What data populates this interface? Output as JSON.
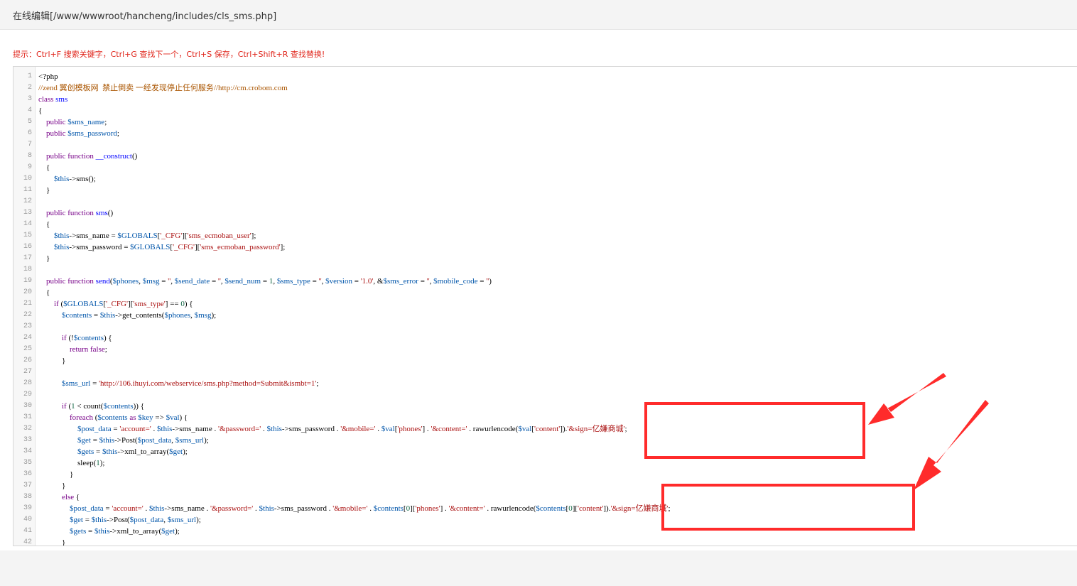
{
  "header": {
    "title": "在线编辑[/www/wwwroot/hancheng/includes/cls_sms.php]"
  },
  "editor": {
    "hint": "提示：Ctrl+F 搜索关键字，Ctrl+G 查找下一个，Ctrl+S 保存，Ctrl+Shift+R 查找替换!",
    "lines": [
      {
        "n": "1",
        "t": "<?php"
      },
      {
        "n": "2",
        "t": "//zend 翼创模板网  禁止倒卖 一经发现停止任何服务//http://cm.crobom.com"
      },
      {
        "n": "3",
        "t": "class sms"
      },
      {
        "n": "4",
        "t": "{"
      },
      {
        "n": "5",
        "t": "    public $sms_name;"
      },
      {
        "n": "6",
        "t": "    public $sms_password;"
      },
      {
        "n": "7",
        "t": ""
      },
      {
        "n": "8",
        "t": "    public function __construct()"
      },
      {
        "n": "9",
        "t": "    {"
      },
      {
        "n": "10",
        "t": "        $this->sms();"
      },
      {
        "n": "11",
        "t": "    }"
      },
      {
        "n": "12",
        "t": ""
      },
      {
        "n": "13",
        "t": "    public function sms()"
      },
      {
        "n": "14",
        "t": "    {"
      },
      {
        "n": "15",
        "t": "        $this->sms_name = $GLOBALS['_CFG']['sms_ecmoban_user'];"
      },
      {
        "n": "16",
        "t": "        $this->sms_password = $GLOBALS['_CFG']['sms_ecmoban_password'];"
      },
      {
        "n": "17",
        "t": "    }"
      },
      {
        "n": "18",
        "t": ""
      },
      {
        "n": "19",
        "t": "    public function send($phones, $msg = '', $send_date = '', $send_num = 1, $sms_type = '', $version = '1.0', &$sms_error = '', $mobile_code = '')"
      },
      {
        "n": "20",
        "t": "    {"
      },
      {
        "n": "21",
        "t": "        if ($GLOBALS['_CFG']['sms_type'] == 0) {"
      },
      {
        "n": "22",
        "t": "            $contents = $this->get_contents($phones, $msg);"
      },
      {
        "n": "23",
        "t": ""
      },
      {
        "n": "24",
        "t": "            if (!$contents) {"
      },
      {
        "n": "25",
        "t": "                return false;"
      },
      {
        "n": "26",
        "t": "            }"
      },
      {
        "n": "27",
        "t": ""
      },
      {
        "n": "28",
        "t": "            $sms_url = 'http://106.ihuyi.com/webservice/sms.php?method=Submit&ismbt=1';"
      },
      {
        "n": "29",
        "t": ""
      },
      {
        "n": "30",
        "t": "            if (1 < count($contents)) {"
      },
      {
        "n": "31",
        "t": "                foreach ($contents as $key => $val) {"
      },
      {
        "n": "32",
        "t": "                    $post_data = 'account=' . $this->sms_name . '&password=' . $this->sms_password . '&mobile=' . $val['phones'] . '&content=' . rawurlencode($val['content']).'&sign=亿嫌商城';"
      },
      {
        "n": "33",
        "t": "                    $get = $this->Post($post_data, $sms_url);"
      },
      {
        "n": "34",
        "t": "                    $gets = $this->xml_to_array($get);"
      },
      {
        "n": "35",
        "t": "                    sleep(1);"
      },
      {
        "n": "36",
        "t": "                }"
      },
      {
        "n": "37",
        "t": "            }"
      },
      {
        "n": "38",
        "t": "            else {"
      },
      {
        "n": "39",
        "t": "                $post_data = 'account=' . $this->sms_name . '&password=' . $this->sms_password . '&mobile=' . $contents[0]['phones'] . '&content=' . rawurlencode($contents[0]['content']).'&sign=亿嫌商城';"
      },
      {
        "n": "40",
        "t": "                $get = $this->Post($post_data, $sms_url);"
      },
      {
        "n": "41",
        "t": "                $gets = $this->xml_to_array($get);"
      },
      {
        "n": "42",
        "t": "            }"
      }
    ]
  },
  "annotations": {
    "color": "#ff2b2b"
  }
}
